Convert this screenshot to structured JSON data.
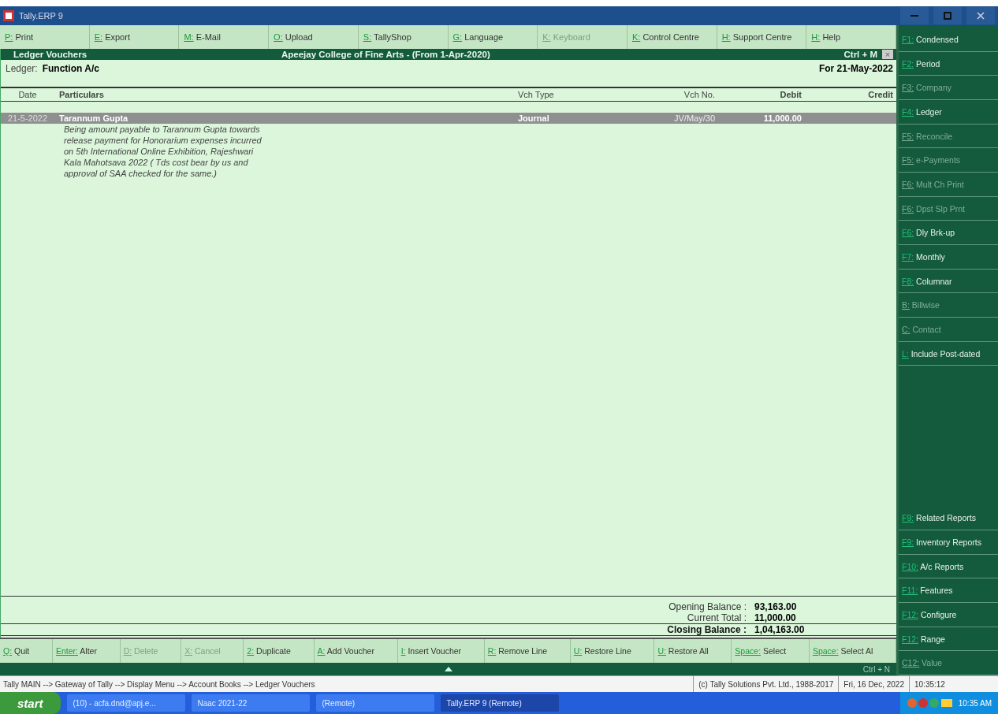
{
  "window": {
    "title": "Tally.ERP 9"
  },
  "top_menu": [
    {
      "key": "P:",
      "label": "Print",
      "disabled": false
    },
    {
      "key": "E:",
      "label": "Export",
      "disabled": false
    },
    {
      "key": "M:",
      "label": "E-Mail",
      "disabled": false
    },
    {
      "key": "O:",
      "label": "Upload",
      "disabled": false
    },
    {
      "key": "S:",
      "label": "TallyShop",
      "disabled": false
    },
    {
      "key": "G:",
      "label": "Language",
      "disabled": false
    },
    {
      "key": "K:",
      "label": "Keyboard",
      "disabled": true
    },
    {
      "key": "K:",
      "label": "Control Centre",
      "disabled": false
    },
    {
      "key": "H:",
      "label": "Support Centre",
      "disabled": false
    },
    {
      "key": "H:",
      "label": "Help",
      "disabled": false
    }
  ],
  "report": {
    "title": "Ledger Vouchers",
    "company": "Apeejay College of Fine Arts - (From 1-Apr-2020)",
    "shortcut": "Ctrl + M",
    "close": "×",
    "ledger_label": "Ledger:",
    "ledger_name": "Function A/c",
    "period": "For 21-May-2022",
    "columns": [
      "Date",
      "Particulars",
      "Vch Type",
      "Vch No.",
      "Debit",
      "Credit"
    ],
    "rows": [
      {
        "date": "21-5-2022",
        "particulars": "Tarannum Gupta",
        "narration": "Being amount payable to Tarannum Gupta towards release payment for Honorarium expenses incurred on 5th International Online Exhibition, Rajeshwari Kala Mahotsava 2022 ( Tds cost bear by us and approval of SAA checked for the same.)",
        "vch_type": "Journal",
        "vch_no": "JV/May/30",
        "debit": "11,000.00",
        "selected": true
      }
    ],
    "totals": [
      {
        "label": "Opening Balance :",
        "debit": "93,163.00",
        "bold": false
      },
      {
        "label": "Current Total :",
        "debit": "11,000.00",
        "bold": false
      },
      {
        "label": "Closing Balance :",
        "debit": "1,04,163.00",
        "bold": true
      }
    ]
  },
  "bottom_bar": [
    {
      "key": "Q:",
      "label": "Quit",
      "disabled": false
    },
    {
      "key": "Enter:",
      "label": "Alter",
      "disabled": false
    },
    {
      "key": "D:",
      "label": "Delete",
      "disabled": true
    },
    {
      "key": "X:",
      "label": "Cancel",
      "disabled": true
    },
    {
      "key": "2:",
      "label": "Duplicate",
      "disabled": false
    },
    {
      "key": "A:",
      "label": "Add Voucher",
      "disabled": false
    },
    {
      "key": "I:",
      "label": "Insert Voucher",
      "disabled": false
    },
    {
      "key": "R:",
      "label": "Remove Line",
      "disabled": false
    },
    {
      "key": "U:",
      "label": "Restore Line",
      "disabled": false
    },
    {
      "key": "U:",
      "label": "Restore All",
      "disabled": false
    },
    {
      "key": "Space:",
      "label": "Select",
      "disabled": false
    },
    {
      "key": "Space:",
      "label": "Select Al",
      "disabled": false
    }
  ],
  "strip": {
    "shortcut": "Ctrl + N"
  },
  "sidebar": {
    "upper": [
      {
        "key": "F1:",
        "label": "Condensed",
        "disabled": false
      },
      {
        "key": "F2:",
        "label": "Period",
        "disabled": false
      },
      {
        "key": "F3:",
        "label": "Company",
        "disabled": true
      },
      {
        "key": "F4:",
        "label": "Ledger",
        "disabled": false
      },
      {
        "key": "F5:",
        "label": "Reconcile",
        "disabled": true
      },
      {
        "key": "F5:",
        "label": "e-Payments",
        "disabled": true
      },
      {
        "key": "F6:",
        "label": "Mult Ch Print",
        "disabled": true
      },
      {
        "key": "F6:",
        "label": "Dpst Slp Prnt",
        "disabled": true
      },
      {
        "key": "F6:",
        "label": "Dly Brk-up",
        "disabled": false
      },
      {
        "key": "F7:",
        "label": "Monthly",
        "disabled": false
      },
      {
        "key": "F8:",
        "label": "Columnar",
        "disabled": false
      },
      {
        "key": "B:",
        "label": "Billwise",
        "disabled": true
      },
      {
        "key": "C:",
        "label": "Contact",
        "disabled": true
      },
      {
        "key": "L:",
        "label": "Include Post-dated",
        "disabled": false
      }
    ],
    "lower": [
      {
        "key": "F9:",
        "label": "Related Reports",
        "disabled": false
      },
      {
        "key": "F9:",
        "label": "Inventory Reports",
        "disabled": false
      },
      {
        "key": "F10:",
        "label": "A/c Reports",
        "disabled": false
      },
      {
        "key": "F11:",
        "label": "Features",
        "disabled": false
      },
      {
        "key": "F12:",
        "label": "Configure",
        "disabled": false
      },
      {
        "key": "F12:",
        "label": "Range",
        "disabled": false
      },
      {
        "key": "C12:",
        "label": "Value",
        "disabled": true
      }
    ]
  },
  "status_bar": {
    "path": "Tally MAIN --> Gateway of Tally --> Display Menu --> Account Books --> Ledger Vouchers",
    "copyright": "(c) Tally Solutions Pvt. Ltd., 1988-2017",
    "date": "Fri, 16 Dec, 2022",
    "time": "10:35:12"
  },
  "taskbar": {
    "start": "start",
    "tasks": [
      {
        "label": "(10) - acfa.dnd@apj.e...",
        "selected": false
      },
      {
        "label": "Naac 2021-22",
        "selected": false
      },
      {
        "label": "(Remote)",
        "selected": false
      },
      {
        "label": "Tally.ERP 9 (Remote)",
        "selected": true
      }
    ],
    "clock": "10:35 AM"
  }
}
